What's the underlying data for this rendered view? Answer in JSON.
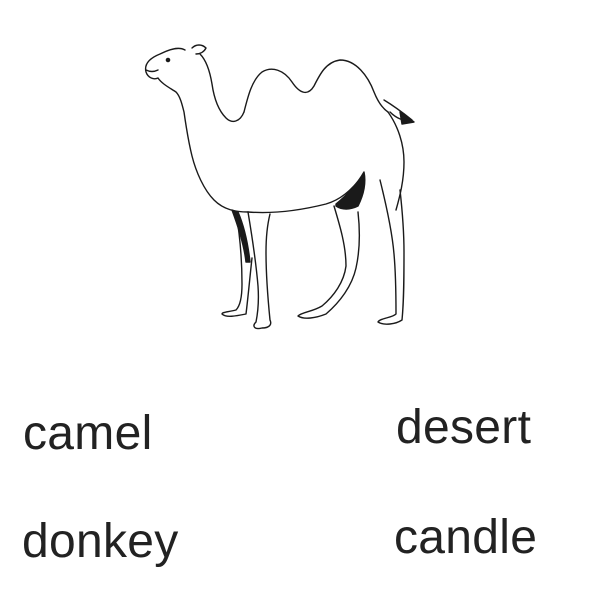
{
  "illustration": {
    "subject": "camel",
    "line_color": "#1a1a1a",
    "fill_color": "#ffffff"
  },
  "choices": [
    {
      "id": "camel",
      "label": "camel"
    },
    {
      "id": "desert",
      "label": "desert"
    },
    {
      "id": "donkey",
      "label": "donkey"
    },
    {
      "id": "candle",
      "label": "candle"
    }
  ],
  "text_color": "#222222",
  "background": "#ffffff"
}
